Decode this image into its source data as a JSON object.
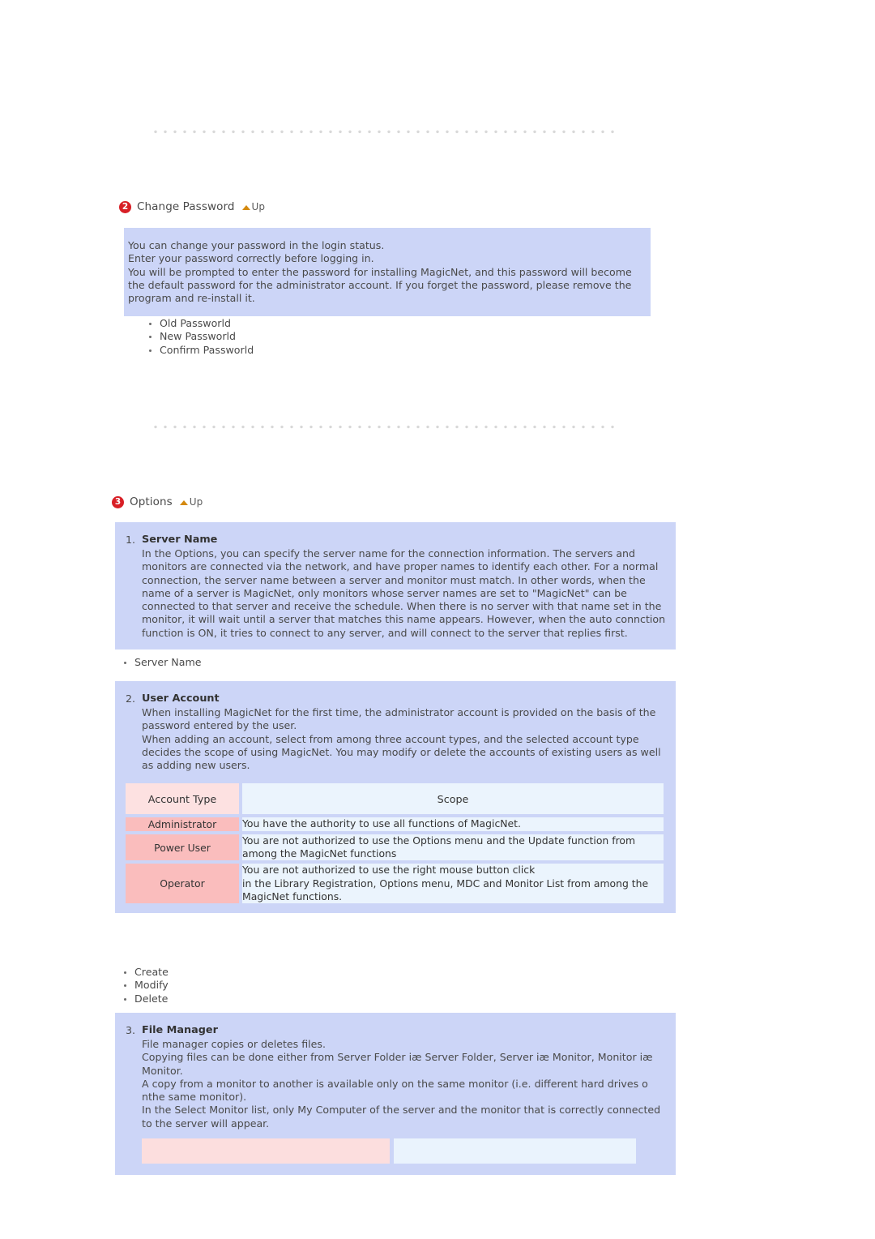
{
  "dividers": [
    {
      "name": "divider-top"
    },
    {
      "name": "divider-mid"
    }
  ],
  "sections": [
    {
      "number": "2",
      "title": "Change Password",
      "up_label": "Up",
      "intro_lines": [
        "You can change your password in the login status.",
        "Enter your password correctly before logging in.",
        "You will be prompted to enter the password for installing MagicNet, and this password will become the default password for the administrator account. If you forget the password, please remove the program and re-install it."
      ],
      "bullets": [
        "Old Passworld",
        "New Passworld",
        "Confirm Passworld"
      ]
    },
    {
      "number": "3",
      "title": "Options",
      "up_label": "Up",
      "items": [
        {
          "marker": "1.",
          "title": "Server Name",
          "text": "In the Options, you can specify the server name for the connection information. The servers and monitors are connected via the network, and have proper names to identify each other. For a normal connection, the server name between a server and monitor must match. In other words, when the name of a server is MagicNet, only monitors whose server names are set to \"MagicNet\" can be connected to that server and receive the schedule. When there is no server with that name set in the monitor, it will wait until a server that matches this name appears. However, when the auto connction function is ON, it tries to connect to any server, and will connect to the server that replies first.",
          "bullets": [
            "Server Name"
          ]
        },
        {
          "marker": "2.",
          "title": "User Account",
          "text_lines": [
            "When installing MagicNet for the first time, the administrator account is provided on the basis of the password entered by the user.",
            "When adding an account, select from among three account types, and the selected account type decides the scope of using MagicNet. You may modify or delete the accounts of existing users as well as adding new users."
          ],
          "bullets": [
            "Create",
            "Modify",
            "Delete"
          ]
        },
        {
          "marker": "3.",
          "title": "File Manager",
          "text_lines": [
            "File manager copies or deletes files.",
            "Copying files can be done either from Server Folder iæ Server Folder, Server iæ Monitor, Monitor iæ Monitor.",
            "A copy from a monitor to another is available only on the same monitor (i.e. different hard drives o nthe same monitor).",
            "In the Select Monitor list, only My Computer of the server and the monitor that is correctly connected to the server will appear."
          ]
        }
      ]
    }
  ],
  "account_table": {
    "headers": {
      "type": "Account Type",
      "scope": "Scope"
    },
    "rows": [
      {
        "type": "Administrator",
        "scope_lines": [
          "You have the authority to use all functions of MagicNet."
        ]
      },
      {
        "type": "Power User",
        "scope_lines": [
          "You are not authorized to use the Options menu and the Update function from",
          "among the MagicNet functions"
        ]
      },
      {
        "type": "Operator",
        "scope_lines": [
          "You are not authorized to use the right mouse button click",
          "in the Library Registration, Options menu, MDC and Monitor List from among the",
          "MagicNet functions."
        ]
      }
    ]
  },
  "file_manager_swatches": {
    "left_label": "",
    "right_label": ""
  },
  "colors": {
    "info_box_bg": "#ccd5f7",
    "badge_red": "#d81f26",
    "up_arrow": "#d4890f",
    "table_header_pink": "#fde1e1",
    "table_cell_pink": "#fabdbd",
    "table_cell_blue": "#ebf4fd",
    "divider_dot": "#d8d8d8"
  }
}
